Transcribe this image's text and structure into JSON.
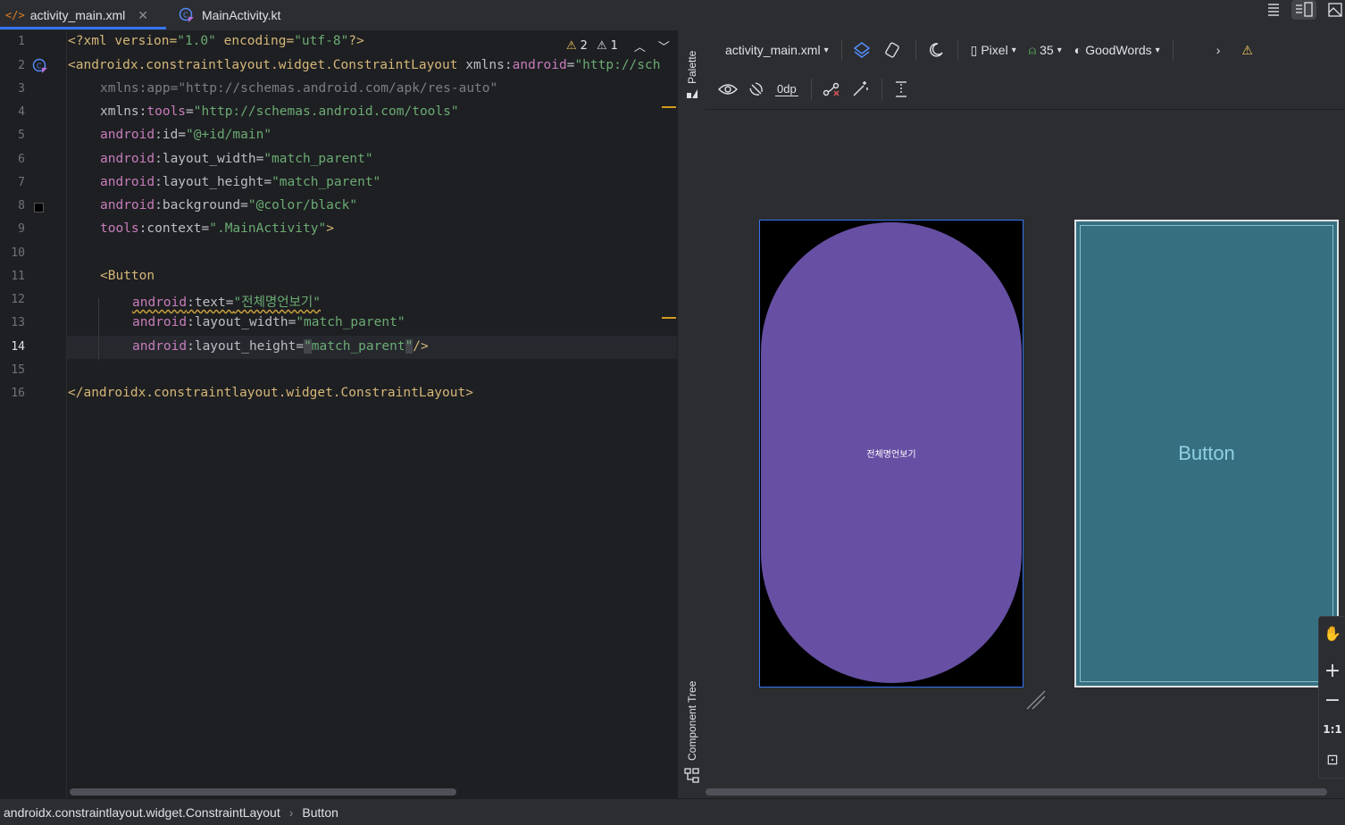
{
  "tabs": [
    {
      "label": "activity_main.xml",
      "icon": "xml-icon",
      "active": true
    },
    {
      "label": "MainActivity.kt",
      "icon": "kotlin-class-icon",
      "active": false
    }
  ],
  "editor": {
    "inspections": {
      "warnings": "2",
      "weak_warnings": "1"
    },
    "line_numbers": [
      "1",
      "2",
      "3",
      "4",
      "5",
      "6",
      "7",
      "8",
      "9",
      "10",
      "11",
      "12",
      "13",
      "14",
      "15",
      "16"
    ],
    "lines": {
      "l1": {
        "a": "<?xml version=",
        "b": "\"1.0\"",
        "c": " encoding=",
        "d": "\"utf-8\"",
        "e": "?>"
      },
      "l2": {
        "a": "<androidx.constraintlayout.widget.ConstraintLayout",
        "b": " xmlns:",
        "c": "android",
        "d": "=",
        "e": "\"http://sch"
      },
      "l3": {
        "a": "xmlns:app=",
        "b": "\"http://schemas.android.com/apk/res-auto\""
      },
      "l4": {
        "a": "xmlns:",
        "b": "tools",
        "c": "=",
        "d": "\"http://schemas.android.com/tools\""
      },
      "l5": {
        "a": "android",
        "b": ":id=",
        "c": "\"@+id/main\""
      },
      "l6": {
        "a": "android",
        "b": ":layout_width=",
        "c": "\"match_parent\""
      },
      "l7": {
        "a": "android",
        "b": ":layout_height=",
        "c": "\"match_parent\""
      },
      "l8": {
        "a": "android",
        "b": ":background=",
        "c": "\"@color/black\""
      },
      "l9": {
        "a": "tools",
        "b": ":context=",
        "c": "\".MainActivity\"",
        "d": ">"
      },
      "l11": {
        "a": "<Button"
      },
      "l12": {
        "a": "android",
        "b": ":text=",
        "c": "\"전체명언보기\""
      },
      "l13": {
        "a": "android",
        "b": ":layout_width=",
        "c": "\"match_parent\""
      },
      "l14": {
        "a": "android",
        "b": ":layout_height=",
        "c": "\"",
        "d": "match_parent",
        "e": "\"",
        "f": "/>"
      },
      "l16": {
        "a": "</androidx.constraintlayout.widget.ConstraintLayout>"
      }
    }
  },
  "side_strip": {
    "palette": "Palette",
    "component_tree": "Component Tree"
  },
  "design_toolbar": {
    "file": "activity_main.xml",
    "device": "Pixel",
    "api": "35",
    "theme": "GoodWords",
    "margin": "0dp"
  },
  "preview": {
    "design_button_text": "전체명언보기",
    "blueprint_button_text": "Button",
    "colors": {
      "button": "#6750a4",
      "background": "#000000",
      "blueprint": "#367080",
      "accent": "#3574f0"
    }
  },
  "zoom_controls": {
    "fit_label": "1:1"
  },
  "statusbar": {
    "breadcrumb": [
      "androidx.constraintlayout.widget.ConstraintLayout",
      "Button"
    ]
  }
}
